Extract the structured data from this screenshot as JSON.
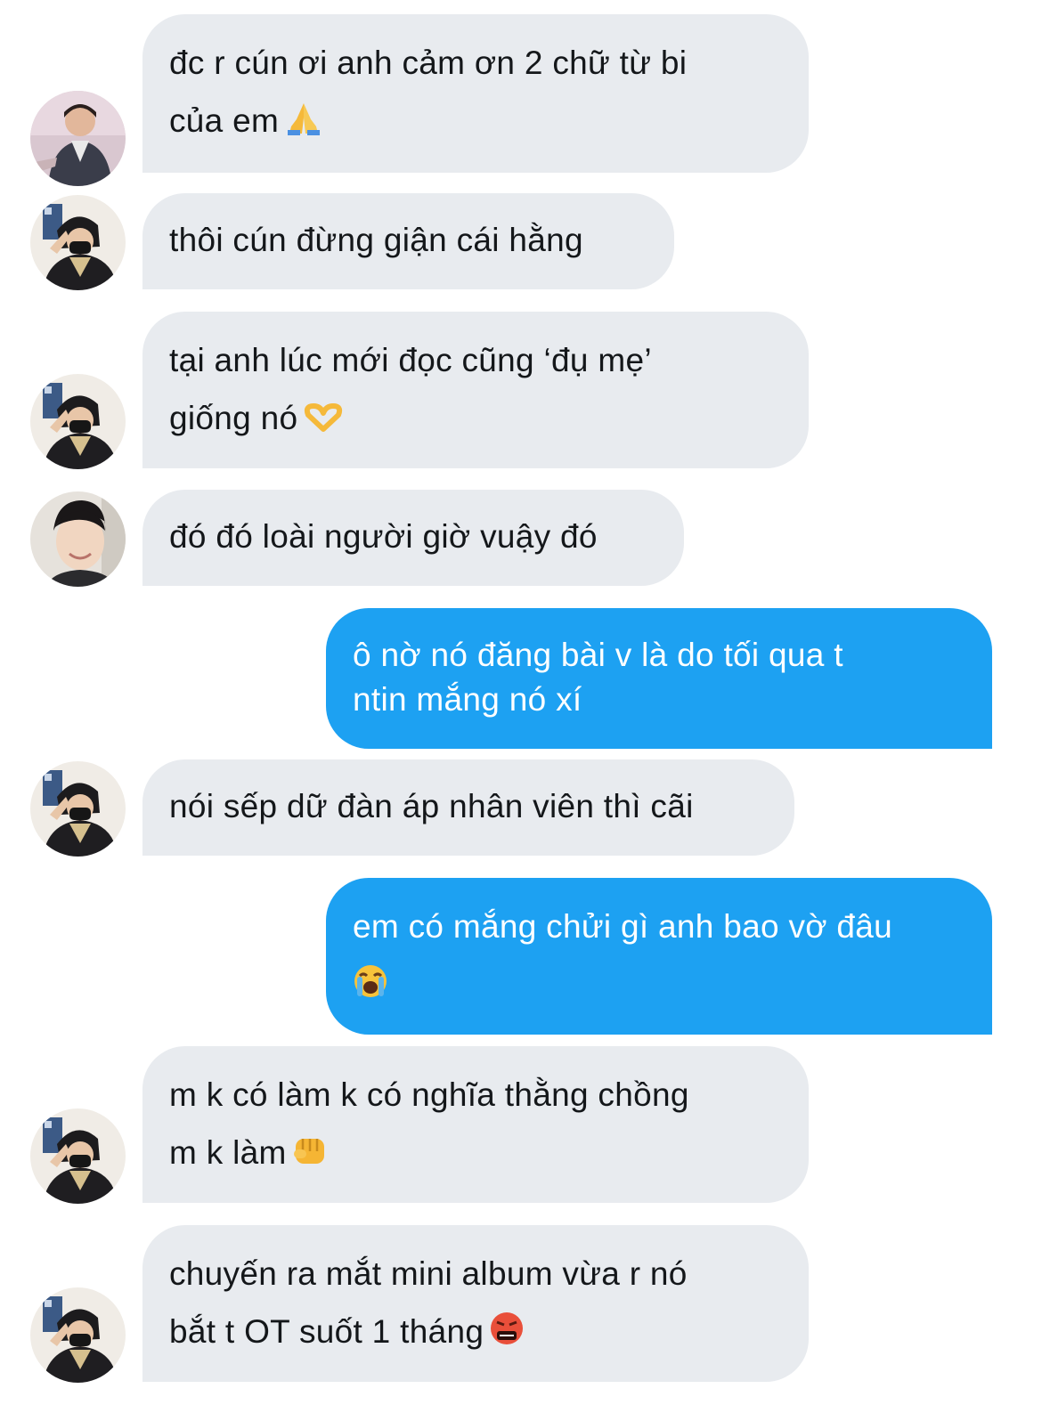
{
  "messages": [
    {
      "side": "in",
      "avatar": "avatar-suit-photo",
      "lines": [
        "đc r cún ơi anh cảm ơn 2 chữ từ bi",
        "của em"
      ],
      "emoji": "folded-hands-emoji"
    },
    {
      "side": "in",
      "avatar": "avatar-masked-photo",
      "lines": [
        "thôi cún đừng giận cái hằng"
      ]
    },
    {
      "side": "in",
      "avatar": "avatar-masked-photo",
      "lines": [
        "tại anh lúc mới đọc cũng ‘đụ mẹ’",
        "giống nó"
      ],
      "emoji": "heart-hands-emoji"
    },
    {
      "side": "in",
      "avatar": "avatar-smiling-photo",
      "lines": [
        "đó đó loài người giờ vuậy đó"
      ]
    },
    {
      "side": "out",
      "lines": [
        "ô nờ nó đăng bài v là do tối qua t",
        "ntin mắng nó xí"
      ]
    },
    {
      "side": "in",
      "avatar": "avatar-masked-photo",
      "lines": [
        "nói sếp dữ đàn áp nhân viên thì cãi"
      ]
    },
    {
      "side": "out",
      "lines": [
        "em có mắng chửi gì anh bao vờ đâu"
      ],
      "emoji": "loudly-crying-face-emoji"
    },
    {
      "side": "in",
      "avatar": "avatar-masked-photo",
      "lines": [
        "m k có làm k có nghĩa thằng chồng",
        "m k làm"
      ],
      "emoji": "oncoming-fist-emoji"
    },
    {
      "side": "in",
      "avatar": "avatar-masked-photo",
      "lines": [
        "chuyến ra mắt mini album vừa r nó",
        "bắt t OT suốt 1 tháng"
      ],
      "emoji": "face-with-symbols-on-mouth-emoji"
    }
  ],
  "colors": {
    "incoming_bubble": "#e8ebef",
    "outgoing_bubble": "#1da1f2",
    "incoming_text": "#14171a",
    "outgoing_text": "#ffffff",
    "background": "#ffffff"
  }
}
